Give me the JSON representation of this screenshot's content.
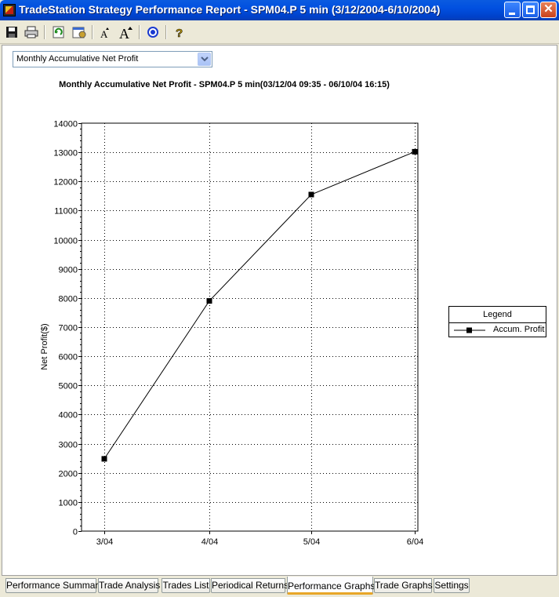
{
  "window": {
    "title": "TradeStation Strategy Performance Report - SPM04.P 5 min (3/12/2004-6/10/2004)",
    "controls": {
      "minimize": "minimize",
      "maximize": "maximize",
      "close": "✕"
    }
  },
  "toolbar": {
    "items": [
      "save-icon",
      "print-icon",
      "refresh-icon",
      "settings-icon",
      "decrease-font-icon",
      "increase-font-icon",
      "target-icon",
      "help-icon"
    ],
    "decrease_font_glyph": "A",
    "increase_font_glyph": "A",
    "help_glyph": "?"
  },
  "graph_select": {
    "selected": "Monthly Accumulative Net Profit"
  },
  "chart_data": {
    "type": "line",
    "title": "Monthly Accumulative Net Profit - SPM04.P 5 min(03/12/04 09:35 - 06/10/04 16:15)",
    "xlabel": "",
    "ylabel": "Net Profit($)",
    "categories": [
      "3/04",
      "4/04",
      "5/04",
      "6/04"
    ],
    "series": [
      {
        "name": "Accum. Profit",
        "values": [
          2480,
          7900,
          11550,
          13020
        ],
        "color": "#000000",
        "marker": "square"
      }
    ],
    "ylim": [
      0,
      14000
    ],
    "yticks": [
      0,
      1000,
      2000,
      3000,
      4000,
      5000,
      6000,
      7000,
      8000,
      9000,
      10000,
      11000,
      12000,
      13000,
      14000
    ],
    "grid": true,
    "grid_style": "dotted",
    "legend": {
      "title": "Legend",
      "placement": "right"
    }
  },
  "tabs": [
    {
      "label": "Performance Summary",
      "active": false
    },
    {
      "label": "Trade Analysis",
      "active": false
    },
    {
      "label": "Trades List",
      "active": false
    },
    {
      "label": "Periodical Returns",
      "active": false
    },
    {
      "label": "Performance Graphs",
      "active": true
    },
    {
      "label": "Trade Graphs",
      "active": false
    },
    {
      "label": "Settings",
      "active": false
    }
  ],
  "colors": {
    "title_bar": "#0054e3",
    "active_tab_accent": "#e8a628",
    "panel_bg": "#ffffff",
    "chrome_bg": "#ece9d8"
  }
}
